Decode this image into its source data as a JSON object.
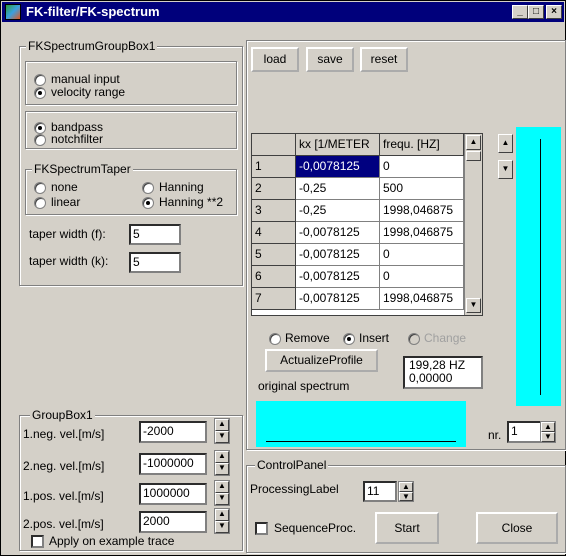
{
  "window": {
    "title": "FK-filter/FK-spectrum",
    "min_label": "_",
    "max_label": "□",
    "close_label": "×"
  },
  "colors": {
    "titlebar": "#00007b",
    "panel": "#d4d0c8",
    "accent_cyan": "#00ffff",
    "selection": "#000080"
  },
  "fk_group": {
    "legend": "FKSpectrumGroupBox1",
    "input_mode": {
      "options": [
        "manual input",
        "velocity range"
      ],
      "selected": "velocity range"
    },
    "filter_type": {
      "options": [
        "bandpass",
        "notchfilter"
      ],
      "selected": "bandpass"
    },
    "taper": {
      "legend": "FKSpectrumTaper",
      "options": [
        "none",
        "Hanning",
        "linear",
        "Hanning **2"
      ],
      "selected": "Hanning **2"
    },
    "taper_width_f": {
      "label": "taper width (f):",
      "value": "5"
    },
    "taper_width_k": {
      "label": "taper width (k):",
      "value": "5"
    }
  },
  "toolbar": {
    "load": "load",
    "save": "save",
    "reset": "reset"
  },
  "table": {
    "columns": [
      "kx [1/METER",
      "frequ. [HZ]"
    ],
    "rows": [
      {
        "n": "1",
        "kx": "-0,0078125",
        "f": "0"
      },
      {
        "n": "2",
        "kx": "-0,25",
        "f": "500"
      },
      {
        "n": "3",
        "kx": "-0,25",
        "f": "1998,046875"
      },
      {
        "n": "4",
        "kx": "-0,0078125",
        "f": "1998,046875"
      },
      {
        "n": "5",
        "kx": "-0,0078125",
        "f": "0"
      },
      {
        "n": "6",
        "kx": "-0,0078125",
        "f": "0"
      },
      {
        "n": "7",
        "kx": "-0,0078125",
        "f": "1998,046875"
      }
    ]
  },
  "edit_mode": {
    "options": [
      "Remove",
      "Insert",
      "Change"
    ],
    "selected": "Insert",
    "disabled": "Change"
  },
  "actualize_button": "ActualizeProfile",
  "readout": {
    "line1": "199,28 HZ",
    "line2": "0,00000"
  },
  "original_spectrum_label": "original spectrum",
  "nr": {
    "label": "nr.",
    "value": "1"
  },
  "group_box1": {
    "legend": "GroupBox1",
    "fields": [
      {
        "label": "1.neg. vel.[m/s]",
        "value": "-2000"
      },
      {
        "label": "2.neg. vel.[m/s]",
        "value": "-1000000"
      },
      {
        "label": "1.pos. vel.[m/s]",
        "value": "1000000"
      },
      {
        "label": "2.pos. vel.[m/s]",
        "value": "2000"
      }
    ],
    "apply_label": "Apply on example trace"
  },
  "control_panel": {
    "legend": "ControlPanel",
    "processing_label": "ProcessingLabel",
    "processing_value": "11",
    "sequence_label": "SequenceProc.",
    "start_label": "Start",
    "close_label": "Close"
  }
}
